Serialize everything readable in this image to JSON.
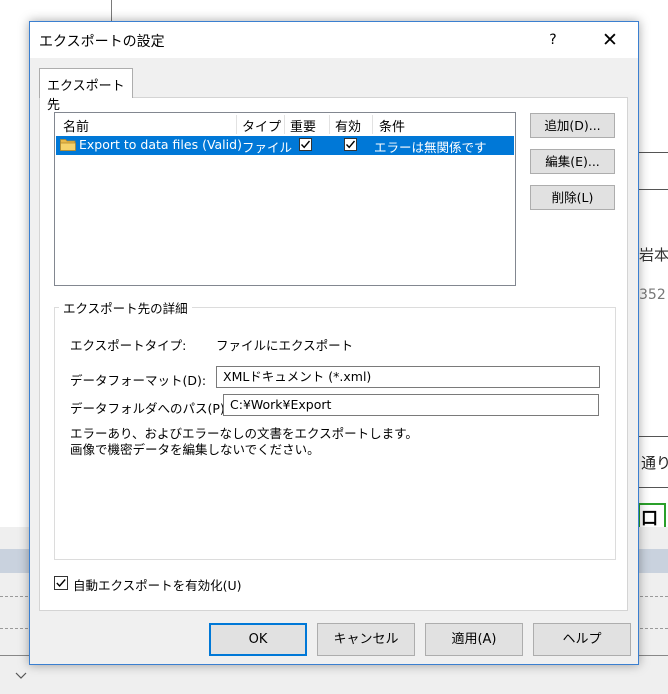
{
  "background": {
    "right_text_1": "岩本I",
    "right_text_2": "352",
    "right_text_3": "通り",
    "right_glyph": "口"
  },
  "dialog": {
    "title": "エクスポートの設定",
    "help_label": "?",
    "close_label": "✕",
    "tab_label": "エクスポート先",
    "list": {
      "columns": [
        "名前",
        "タイプ",
        "重要",
        "有効",
        "条件"
      ],
      "rows": [
        {
          "name": "Export to data files (Valid)",
          "type": "ファイル",
          "important": true,
          "enabled": true,
          "condition": "エラーは無関係です",
          "selected": true,
          "icon": "folder-icon"
        }
      ]
    },
    "side_buttons": {
      "add": "追加(D)...",
      "edit": "編集(E)...",
      "delete": "削除(L)"
    },
    "details": {
      "group_title": "エクスポート先の詳細",
      "export_type_label": "エクスポートタイプ:",
      "export_type_value": "ファイルにエクスポート",
      "data_format_label": "データフォーマット(D):",
      "data_format_value": "XMLドキュメント (*.xml)",
      "folder_path_label": "データフォルダへのパス(P):",
      "folder_path_value": "C:¥Work¥Export",
      "note_line1": "エラーあり、およびエラーなしの文書をエクスポートします。",
      "note_line2": "画像で機密データを編集しないでください。"
    },
    "auto_export_label": "自動エクスポートを有効化(U)",
    "auto_export_checked": true,
    "buttons": {
      "ok": "OK",
      "cancel": "キャンセル",
      "apply": "適用(A)",
      "help": "ヘルプ"
    },
    "colors": {
      "selection": "#0078d7",
      "border_accent": "#3b7fd0"
    }
  }
}
